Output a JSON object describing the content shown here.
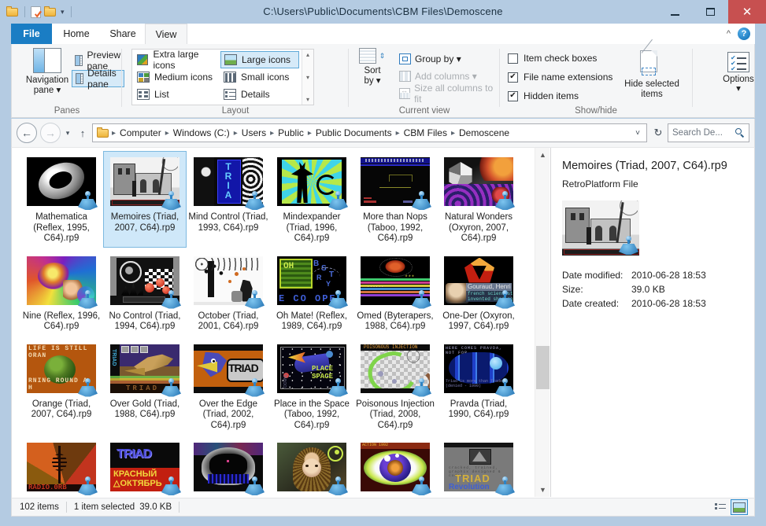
{
  "window": {
    "title": "C:\\Users\\Public\\Documents\\CBM Files\\Demoscene",
    "minimize_label": "Minimize",
    "maximize_label": "Maximize",
    "close_label": "Close"
  },
  "quick_access": {
    "folder_icon": "folder-icon",
    "properties_icon": "properties-icon",
    "new_folder_icon": "new-folder-icon",
    "customize_label": "▾"
  },
  "tabs": [
    {
      "id": "file",
      "label": "File"
    },
    {
      "id": "home",
      "label": "Home"
    },
    {
      "id": "share",
      "label": "Share"
    },
    {
      "id": "view",
      "label": "View"
    }
  ],
  "tab_right": {
    "collapse_label": "^",
    "help_label": "?"
  },
  "ribbon": {
    "groups": [
      {
        "id": "panes",
        "label": "Panes"
      },
      {
        "id": "layout",
        "label": "Layout"
      },
      {
        "id": "current-view",
        "label": "Current view"
      },
      {
        "id": "show-hide",
        "label": "Show/hide"
      }
    ],
    "panes": {
      "navigation_pane": "Navigation\npane",
      "navigation_pane_line1": "Navigation",
      "navigation_pane_line2": "pane ▾",
      "preview_pane": "Preview pane",
      "details_pane": "Details pane"
    },
    "layout": {
      "extra_large_icons": "Extra large icons",
      "large_icons": "Large icons",
      "medium_icons": "Medium icons",
      "small_icons": "Small icons",
      "list": "List",
      "details": "Details",
      "selected": "Large icons",
      "scroll_up": "▴",
      "scroll_down": "▾",
      "scroll_more": "▾"
    },
    "current_view": {
      "sort_by_line1": "Sort",
      "sort_by_line2": "by ▾",
      "group_by": "Group by ▾",
      "add_columns": "Add columns ▾",
      "size_all_columns": "Size all columns to fit"
    },
    "show_hide": {
      "item_check_boxes": "Item check boxes",
      "item_check_boxes_checked": false,
      "file_name_extensions": "File name extensions",
      "file_name_extensions_checked": true,
      "hidden_items": "Hidden items",
      "hidden_items_checked": true,
      "hide_selected_line1": "Hide selected",
      "hide_selected_line2": "items",
      "options_line1": "Options",
      "options_line2": "▾"
    }
  },
  "addressbar": {
    "back_label": "←",
    "forward_label": "→",
    "recent_label": "▾",
    "up_label": "↑",
    "breadcrumbs": [
      "Computer",
      "Windows (C:)",
      "Users",
      "Public",
      "Public Documents",
      "CBM Files",
      "Demoscene"
    ],
    "separator": "▸",
    "dropdown_label": "˅",
    "refresh_label": "↻",
    "search_placeholder": "Search De..."
  },
  "files": [
    {
      "name": "Mathematica (Reflex, 1995, C64).rp9",
      "thumb": "torus-grayscale",
      "selected": false
    },
    {
      "name": "Memoires (Triad, 2007, C64).rp9",
      "thumb": "monastery-bw",
      "selected": true
    },
    {
      "name": "Mind Control (Triad, 1993, C64).rp9",
      "thumb": "triad-faces",
      "selected": false
    },
    {
      "name": "Mindexpander (Triad, 1996, C64).rp9",
      "thumb": "om-figure",
      "selected": false
    },
    {
      "name": "More than Nops (Taboo, 1992, C64).rp9",
      "thumb": "dark-textmode",
      "selected": false
    },
    {
      "name": "Natural Wonders (Oxyron, 2007, C64).rp9",
      "thumb": "crystal-coral",
      "selected": false
    },
    {
      "name": "Nine (Reflex, 1996, C64).rp9",
      "thumb": "psychedelic-swirl",
      "selected": false
    },
    {
      "name": "No Control (Triad, 1994, C64).rp9",
      "thumb": "checker-spheres",
      "selected": false
    },
    {
      "name": "October (Triad, 2001, C64).rp9",
      "thumb": "tree-couple",
      "selected": false
    },
    {
      "name": "Oh Mate! (Reflex, 1989, C64).rp9",
      "thumb": "green-logo",
      "selected": false
    },
    {
      "name": "Omed (Byterapers, 1988, C64).rp9",
      "thumb": "rainbow-lines",
      "selected": false
    },
    {
      "name": "One-Der (Oxyron, 1997, C64).rp9",
      "thumb": "gouraud-triangle",
      "selected": false
    },
    {
      "name": "Orange (Triad, 2007, C64).rp9",
      "thumb": "orange-globe",
      "selected": false
    },
    {
      "name": "Over Gold (Triad, 1988, C64).rp9",
      "thumb": "eagle-scene",
      "selected": false
    },
    {
      "name": "Over the Edge (Triad, 2002, C64).rp9",
      "thumb": "triad-bird",
      "selected": false
    },
    {
      "name": "Place in the Space (Taboo, 1992, C64).rp9",
      "thumb": "spaceship",
      "selected": false
    },
    {
      "name": "Poisonous Injection (Triad, 2008, C64).rp9",
      "thumb": "green-worm",
      "selected": false
    },
    {
      "name": "Pravda (Triad, 1990, C64).rp9",
      "thumb": "blue-tunnel",
      "selected": false
    },
    {
      "name": "",
      "thumb": "radio-tower",
      "selected": false
    },
    {
      "name": "",
      "thumb": "krasny-oktyabr",
      "selected": false
    },
    {
      "name": "",
      "thumb": "mirror-blue",
      "selected": false
    },
    {
      "name": "",
      "thumb": "medusa-girl",
      "selected": false
    },
    {
      "name": "",
      "thumb": "blue-eye",
      "selected": false
    },
    {
      "name": "",
      "thumb": "triad-revolution",
      "selected": false
    }
  ],
  "details_pane": {
    "title": "Memoires (Triad, 2007, C64).rp9",
    "type": "RetroPlatform File",
    "thumb": "monastery-bw",
    "rows": [
      {
        "key": "Date modified:",
        "value": "2010-06-28 18:53"
      },
      {
        "key": "Size:",
        "value": "39.0 KB"
      },
      {
        "key": "Date created:",
        "value": "2010-06-28 18:53"
      }
    ]
  },
  "status": {
    "item_count": "102 items",
    "selection": "1 item selected",
    "selection_size": "39.0 KB",
    "details_view_label": "Details view",
    "large_icons_view_label": "Large icons view"
  },
  "colors": {
    "accent": "#1a7dc4",
    "titlebar": "#b4cbe2",
    "close_button": "#c75050",
    "selection": "#cfe8f9",
    "selection_border": "#7db9e0"
  }
}
